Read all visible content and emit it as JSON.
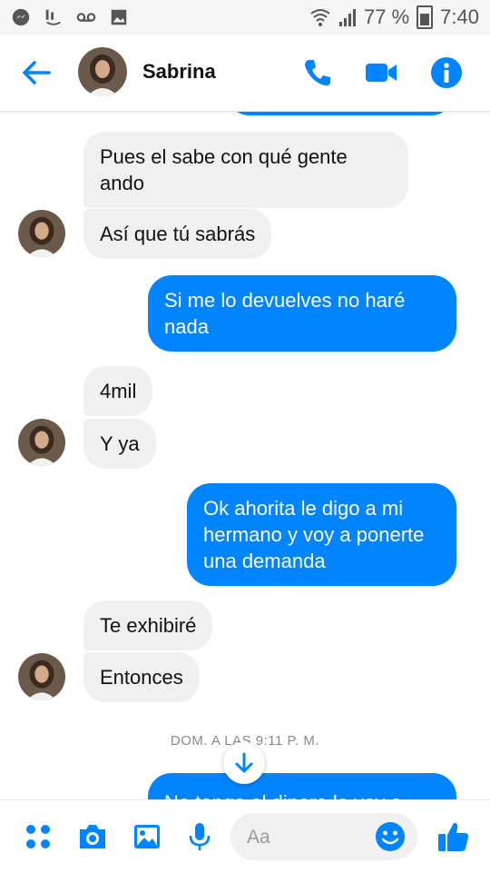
{
  "status_bar": {
    "battery_percent": "77 %",
    "time": "7:40"
  },
  "header": {
    "contact_name": "Sabrina",
    "accent_color": "#0084ff"
  },
  "messages": [
    {
      "direction": "incoming",
      "text": "Pues el sabe con qué gente ando"
    },
    {
      "direction": "incoming",
      "text": "Así que tú sabrás"
    },
    {
      "direction": "outgoing",
      "text": "Si me lo devuelves no haré nada"
    },
    {
      "direction": "incoming",
      "text": "4mil"
    },
    {
      "direction": "incoming",
      "text": "Y ya"
    },
    {
      "direction": "outgoing",
      "text": "Ok ahorita le digo a mi hermano y voy a ponerte una demanda"
    },
    {
      "direction": "incoming",
      "text": "Te exhibiré"
    },
    {
      "direction": "incoming",
      "text": "Entonces"
    },
    {
      "direction": "outgoing",
      "text": "No tengo el dinero lo voy a"
    }
  ],
  "timestamp": "DOM. A LAS 9:11 P. M.",
  "composer": {
    "placeholder": "Aa"
  },
  "icons": {
    "back": "arrow-left-icon",
    "call": "phone-icon",
    "video": "video-camera-icon",
    "info": "info-icon",
    "more": "four-dots-icon",
    "camera": "camera-icon",
    "gallery": "image-icon",
    "mic": "microphone-icon",
    "emoji": "smiley-icon",
    "like": "thumbs-up-icon",
    "scroll_down": "arrow-down-icon"
  }
}
